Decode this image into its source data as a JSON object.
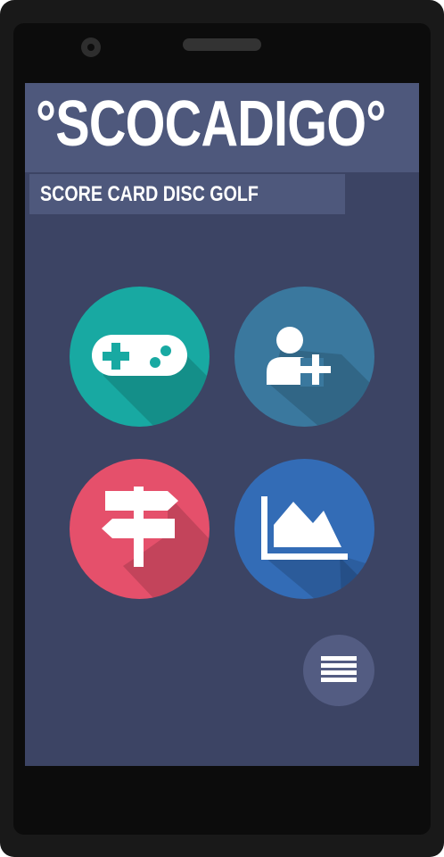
{
  "app": {
    "title": "°SCOCADIGO°",
    "subtitle": "SCORE CARD DISC GOLF"
  },
  "buttons": [
    {
      "id": "play",
      "icon": "gamepad-icon",
      "color": "#18a9a2"
    },
    {
      "id": "add-player",
      "icon": "add-user-icon",
      "color": "#3a789e"
    },
    {
      "id": "courses",
      "icon": "signpost-icon",
      "color": "#e5506b"
    },
    {
      "id": "statistics",
      "icon": "area-chart-icon",
      "color": "#336cb6"
    }
  ],
  "menu": {
    "icon": "menu-icon",
    "color": "#535c82"
  },
  "colors": {
    "screen_background": "#3c4464",
    "header_background": "#4e587c",
    "device_body": "#191919"
  }
}
